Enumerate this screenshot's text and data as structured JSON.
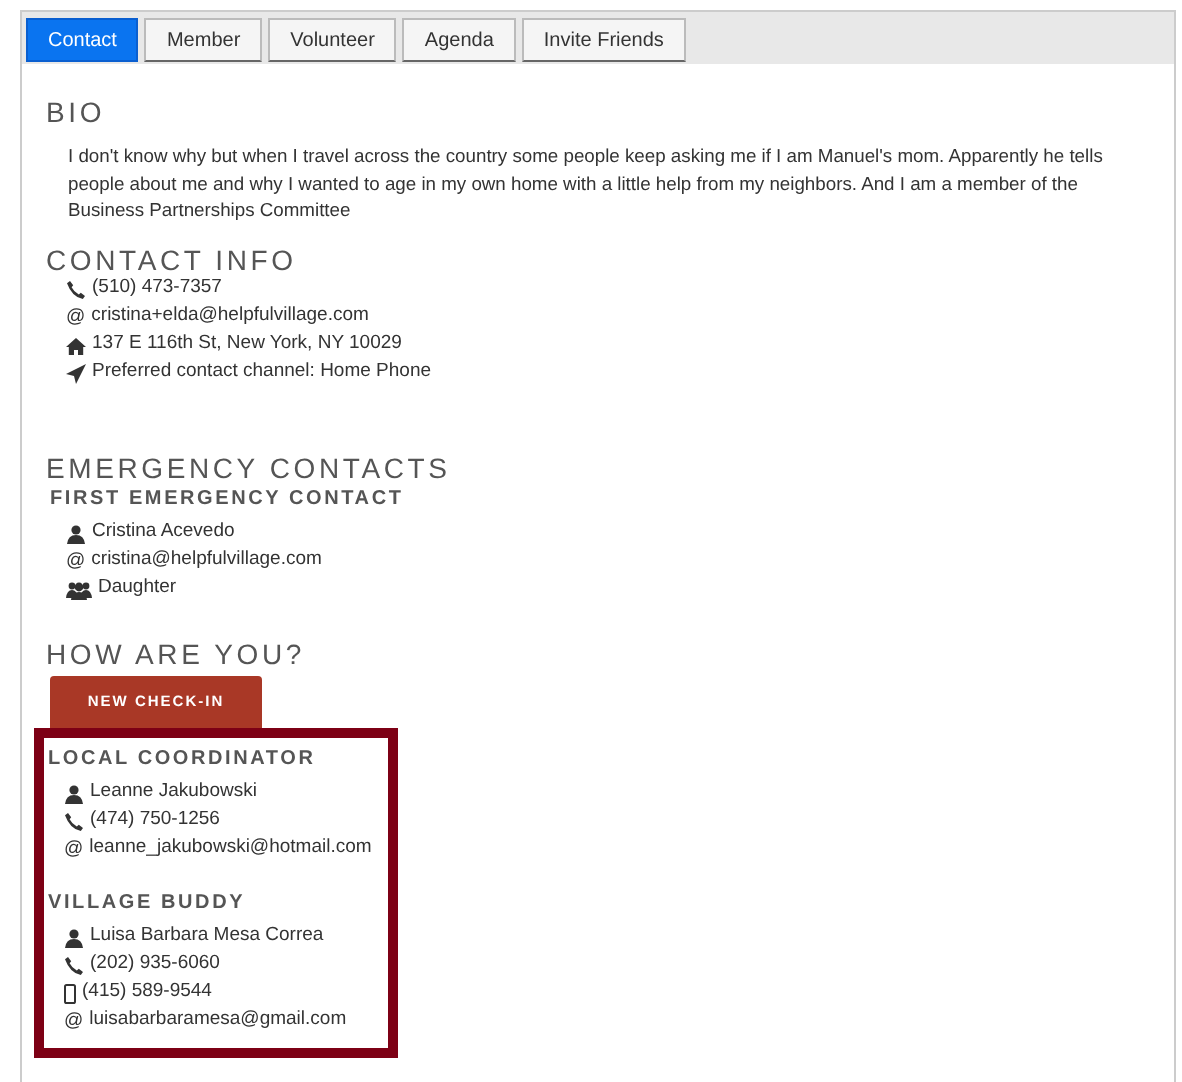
{
  "tabs": [
    {
      "label": "Contact",
      "selected": true
    },
    {
      "label": "Member",
      "selected": false
    },
    {
      "label": "Volunteer",
      "selected": false
    },
    {
      "label": "Agenda",
      "selected": false
    },
    {
      "label": "Invite Friends",
      "selected": false
    }
  ],
  "bio": {
    "heading": "BIO",
    "text": "I don't know why but when I travel across the country some people keep asking me if I am Manuel's mom. Apparently he tells people about me and why I wanted to age in my own home with a little help from my neighbors. And I am a member of the Business Partnerships Committee"
  },
  "contact_info": {
    "heading": "CONTACT INFO",
    "items": [
      {
        "kind": "phone",
        "text": "(510) 473-7357"
      },
      {
        "kind": "email",
        "glyph": "@",
        "text": "cristina+elda@helpfulvillage.com"
      },
      {
        "kind": "home",
        "text": "137 E 116th St, New York, NY 10029"
      },
      {
        "kind": "send",
        "text": "Preferred contact channel: Home Phone"
      }
    ]
  },
  "emergency": {
    "heading": "EMERGENCY CONTACTS",
    "subheading": "FIRST EMERGENCY CONTACT",
    "items": [
      {
        "kind": "user",
        "text": "Cristina Acevedo"
      },
      {
        "kind": "email",
        "glyph": "@",
        "text": "cristina@helpfulvillage.com"
      },
      {
        "kind": "group",
        "text": "Daughter"
      }
    ]
  },
  "checkin": {
    "heading": "HOW ARE YOU?",
    "button": "NEW CHECK-IN"
  },
  "support": [
    {
      "heading": "LOCAL COORDINATOR",
      "items": [
        {
          "kind": "user",
          "text": "Leanne Jakubowski"
        },
        {
          "kind": "phone",
          "text": "(474) 750-1256"
        },
        {
          "kind": "email",
          "glyph": "@",
          "text": "leanne_jakubowski@hotmail.com"
        }
      ]
    },
    {
      "heading": "VILLAGE BUDDY",
      "items": [
        {
          "kind": "user",
          "text": "Luisa Barbara Mesa Correa"
        },
        {
          "kind": "phone",
          "text": "(202) 935-6060"
        },
        {
          "kind": "mobile",
          "text": "(415) 589-9544"
        },
        {
          "kind": "email",
          "glyph": "@",
          "text": "luisabarbaramesa@gmail.com"
        }
      ]
    }
  ]
}
